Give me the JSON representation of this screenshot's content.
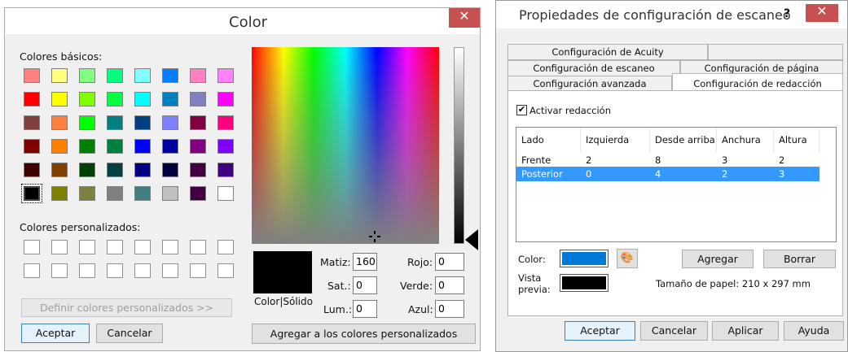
{
  "color_dialog": {
    "title": "Color",
    "close": "✕",
    "basic_label": "Colores básicos:",
    "basic_colors": [
      "#ff8080",
      "#ffff80",
      "#80ff80",
      "#00ff80",
      "#80ffff",
      "#0080ff",
      "#ff80c0",
      "#ff80ff",
      "#ff0000",
      "#ffff00",
      "#80ff00",
      "#00ff40",
      "#00ffff",
      "#0080c0",
      "#8080c0",
      "#ff00ff",
      "#804040",
      "#ff8040",
      "#00ff00",
      "#008080",
      "#004080",
      "#8080ff",
      "#800040",
      "#ff0080",
      "#800000",
      "#ff8000",
      "#008000",
      "#008040",
      "#0000ff",
      "#0000a0",
      "#800080",
      "#8000ff",
      "#400000",
      "#804000",
      "#004000",
      "#004040",
      "#000080",
      "#000040",
      "#400040",
      "#400080",
      "#000000",
      "#808000",
      "#808040",
      "#808080",
      "#408080",
      "#c0c0c0",
      "#400040",
      "#ffffff"
    ],
    "custom_label": "Colores personalizados:",
    "define_button": "Definir colores personalizados >>",
    "ok_button": "Aceptar",
    "cancel_button": "Cancelar",
    "preview_label": "Color|Sólido",
    "hue_label": "Matiz:",
    "hue_value": "160",
    "sat_label": "Sat.:",
    "sat_value": "0",
    "lum_label": "Lum.:",
    "lum_value": "0",
    "red_label": "Rojo:",
    "red_value": "0",
    "green_label": "Verde:",
    "green_value": "0",
    "blue_label": "Azul:",
    "blue_value": "0",
    "add_custom_button": "Agregar a los colores personalizados"
  },
  "scan_dialog": {
    "title": "Propiedades de configuración de escaneo",
    "help": "?",
    "close": "✕",
    "tabs": {
      "acuity": "Configuración de Acuity",
      "scan": "Configuración de escaneo",
      "page": "Configuración de página",
      "advanced": "Configuración avanzada",
      "redaction": "Configuración de redacción"
    },
    "activate_label": "Activar redacción",
    "activate_check": "✔",
    "columns": [
      "Lado",
      "Izquierda",
      "Desde arriba",
      "Anchura",
      "Altura"
    ],
    "rows": [
      [
        "Frente",
        "2",
        "8",
        "3",
        "2"
      ],
      [
        "Posterior",
        "0",
        "4",
        "2",
        "3"
      ]
    ],
    "color_label": "Color:",
    "color_value": "#0078d7",
    "palette_icon": "🎨",
    "add_button": "Agregar",
    "delete_button": "Borrar",
    "preview_label_1": "Vista",
    "preview_label_2": "previa:",
    "preview_value": "#000000",
    "paper_size": "Tamaño de papel: 210 x 297 mm",
    "ok_button": "Aceptar",
    "cancel_button": "Cancelar",
    "apply_button": "Aplicar",
    "help_button": "Ayuda"
  }
}
